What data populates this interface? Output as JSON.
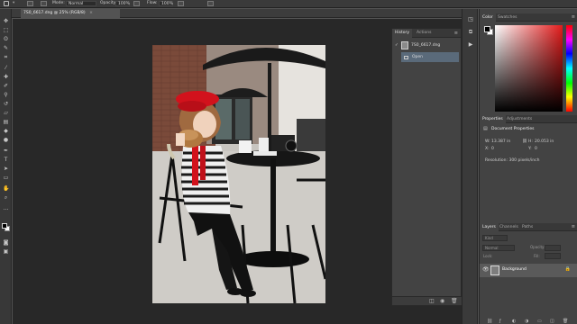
{
  "options_bar": {
    "mode_label": "Mode:",
    "mode_value": "Normal",
    "opacity_label": "Opacity:",
    "opacity_value": "100%",
    "flow_label": "Flow:",
    "flow_value": "100%"
  },
  "document": {
    "tab_title": "7S0_6617.dng @ 25% (RGB/8)",
    "close_glyph": "×"
  },
  "history_panel": {
    "tabs": [
      "History",
      "Actions"
    ],
    "snapshot_name": "7S0_6617.dng",
    "states": [
      "Open"
    ]
  },
  "color_panel": {
    "tabs": [
      "Color",
      "Swatches"
    ],
    "foreground": "#000000",
    "background": "#ffffff"
  },
  "properties_panel": {
    "tabs": [
      "Properties",
      "Adjustments"
    ],
    "title": "Document Properties",
    "width_label": "W:",
    "width_value": "13.387 in",
    "height_label": "H:",
    "height_value": "20.053 in",
    "x_label": "X:",
    "x_value": "0",
    "y_label": "Y:",
    "y_value": "0",
    "resolution": "Resolution: 300 pixels/inch"
  },
  "layers_panel": {
    "tabs": [
      "Layers",
      "Channels",
      "Paths"
    ],
    "kind_placeholder": "Kind",
    "blend_mode": "Normal",
    "opacity_label": "Opacity:",
    "lock_label": "Lock:",
    "fill_label": "Fill:",
    "layers": [
      {
        "name": "Background",
        "locked": true
      }
    ]
  },
  "colors": {
    "app_bg": "#535353",
    "canvas_bg": "#282828",
    "panel_bg": "#434343",
    "selected_row": "#5a5a5a",
    "beret_red": "#d2121c"
  }
}
